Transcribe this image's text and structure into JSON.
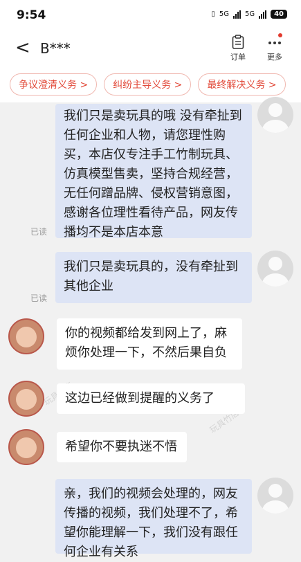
{
  "status_bar": {
    "time": "9:54",
    "signal_1": "5G",
    "signal_2": "5G",
    "battery": "40"
  },
  "header": {
    "back_glyph": "<",
    "contact_name": "B***",
    "order_label": "订单",
    "more_label": "更多"
  },
  "chips": [
    {
      "label": "争议澄清义务 >"
    },
    {
      "label": "纠纷主导义务 >"
    },
    {
      "label": "最终解决义务 >"
    }
  ],
  "messages": [
    {
      "side": "out",
      "text": "我们只是卖玩具的哦 没有牵扯到任何企业和人物，请您理性购买，本店仅专注手工竹制玩具、仿真模型售卖，坚持合规经营，无任何蹭品牌、侵权营销意图，感谢各位理性看待产品，网友传播均不是本店本意",
      "status": "已读"
    },
    {
      "side": "out",
      "text": "我们只是卖玩具的，没有牵扯到其他企业",
      "status": "已读"
    },
    {
      "side": "in",
      "text": "你的视频都给发到网上了，麻烦你处理一下，不然后果自负"
    },
    {
      "side": "in",
      "text": "这边已经做到提醒的义务了"
    },
    {
      "side": "in",
      "text": "希望你不要执迷不悟"
    },
    {
      "side": "out",
      "text": "亲，我们的视频会处理的，网友传播的视频，我们处理不了，希望你能理解一下，我们没有跟任何企业有关系"
    }
  ],
  "icons": {
    "back": "chevron-left-icon",
    "order": "clipboard-icon",
    "more": "more-dots-icon",
    "battery": "battery-icon",
    "signal": "signal-bars-icon"
  }
}
